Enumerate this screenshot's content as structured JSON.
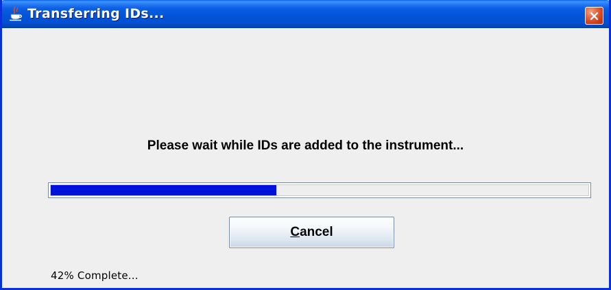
{
  "window": {
    "title": "Transferring IDs...",
    "app_icon": "java-cup-icon",
    "close_icon": "close-icon"
  },
  "dialog": {
    "message": "Please wait while IDs are added to the instrument...",
    "progress": {
      "percent": 42,
      "fill_color": "#0011d9"
    },
    "cancel_button": {
      "mnemonic": "C",
      "rest": "ancel"
    },
    "status_text": "42% Complete..."
  },
  "colors": {
    "titlebar": "#0354d8",
    "window_border": "#0831d9",
    "close_button": "#cf3d16",
    "body_background": "#efefef"
  }
}
